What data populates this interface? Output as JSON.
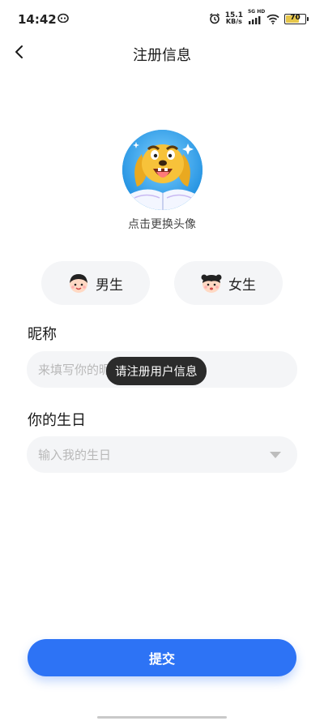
{
  "status_bar": {
    "time": "14:42",
    "net_speed_value": "15.1",
    "net_speed_unit": "KB/s",
    "signal_label": "5G HD",
    "battery": "70"
  },
  "nav": {
    "title": "注册信息"
  },
  "avatar": {
    "caption": "点击更换头像"
  },
  "gender": {
    "male_label": "男生",
    "female_label": "女生"
  },
  "nickname": {
    "label": "昵称",
    "placeholder": "来填写你的昵称"
  },
  "birthday": {
    "label": "你的生日",
    "placeholder": "输入我的生日"
  },
  "toast": {
    "text": "请注册用户信息"
  },
  "submit": {
    "label": "提交"
  },
  "colors": {
    "primary": "#2d73f5",
    "field_bg": "#f4f5f7",
    "toast_bg": "#2b2b2b",
    "battery": "#e6c64a"
  }
}
